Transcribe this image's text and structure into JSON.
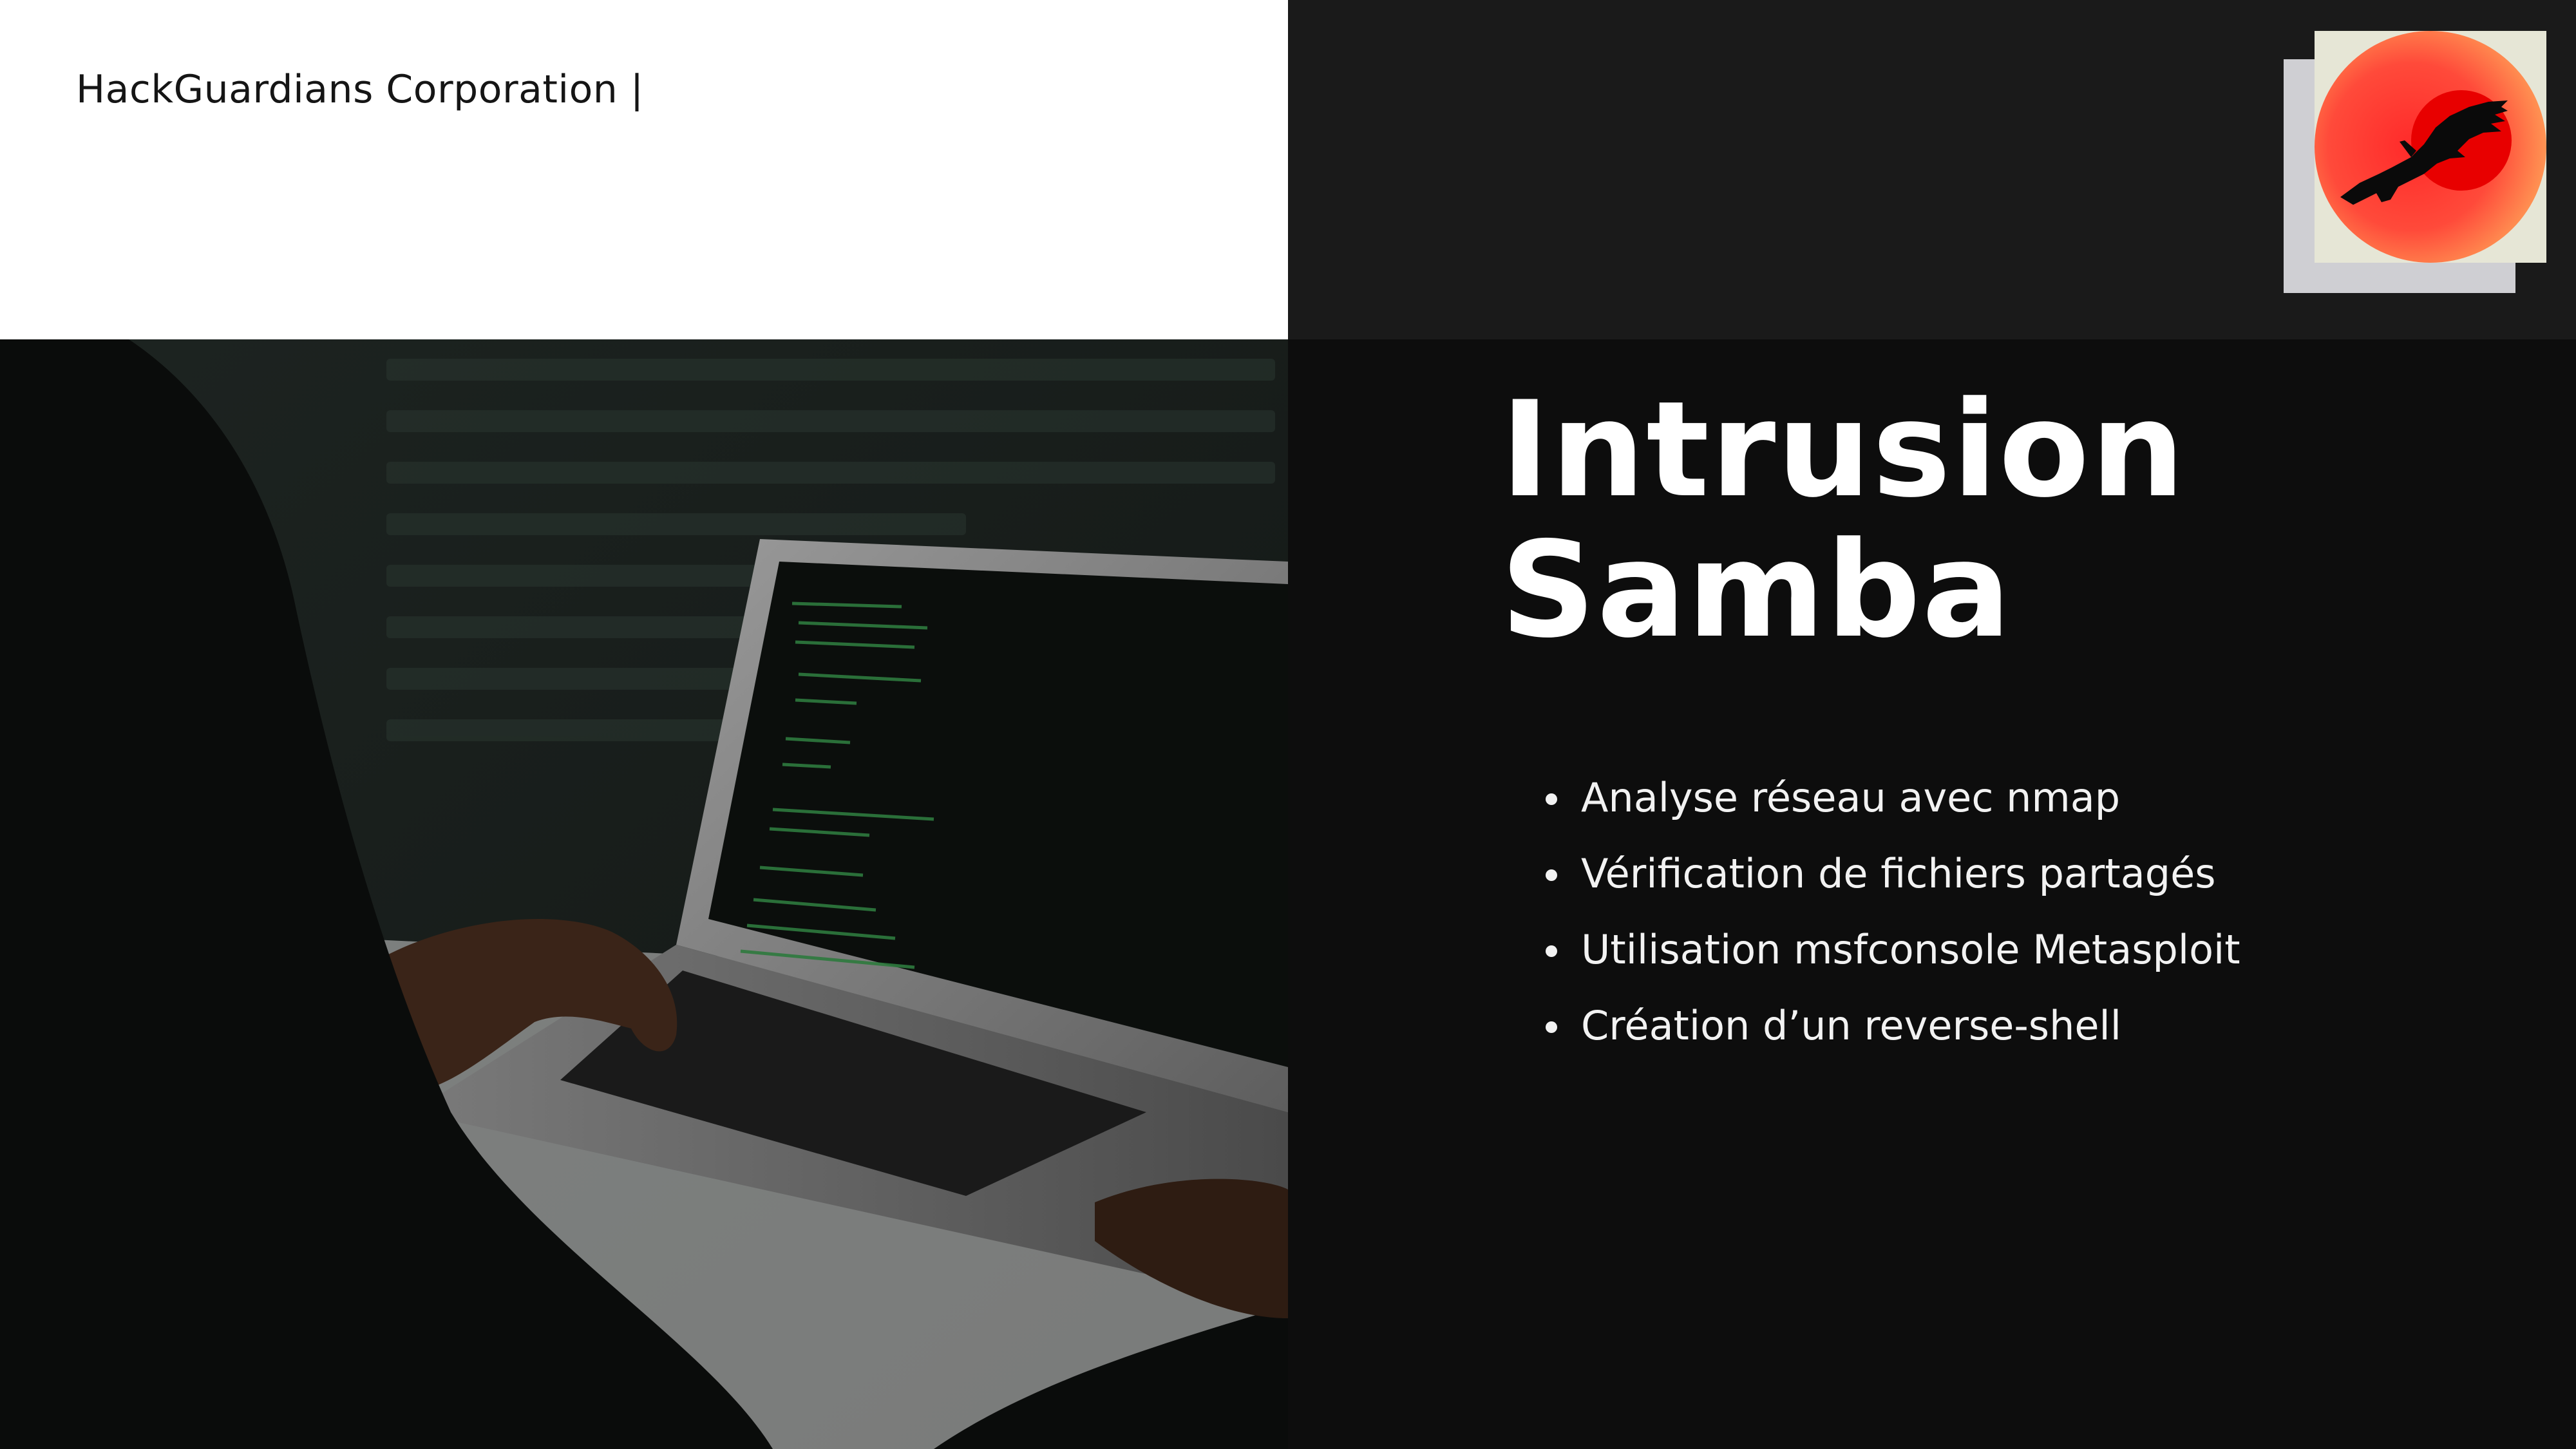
{
  "header": {
    "company": "HackGuardians Corporation |"
  },
  "title": {
    "line1": "Intrusion",
    "line2": "Samba"
  },
  "bullets": [
    {
      "label": "Analyse réseau avec nmap"
    },
    {
      "label": "Vérification de fichiers partagés"
    },
    {
      "label": "Utilisation msfconsole Metasploit"
    },
    {
      "label": "Création d’un reverse-shell"
    }
  ],
  "logo": {
    "icon": "eagle-on-red-sun-icon",
    "colors": {
      "sun_inner": "#ff2a2a",
      "sun_outer": "#ff9a55",
      "eagle": "#0a0a0a",
      "card": "#e6e6d6"
    }
  },
  "photo": {
    "icon": "hacker-laptop-photo"
  },
  "colors": {
    "header_bg": "#ffffff",
    "dark_band": "#1a1a1a",
    "panel_bg": "#0d0d0d",
    "text_light": "#ffffff"
  }
}
